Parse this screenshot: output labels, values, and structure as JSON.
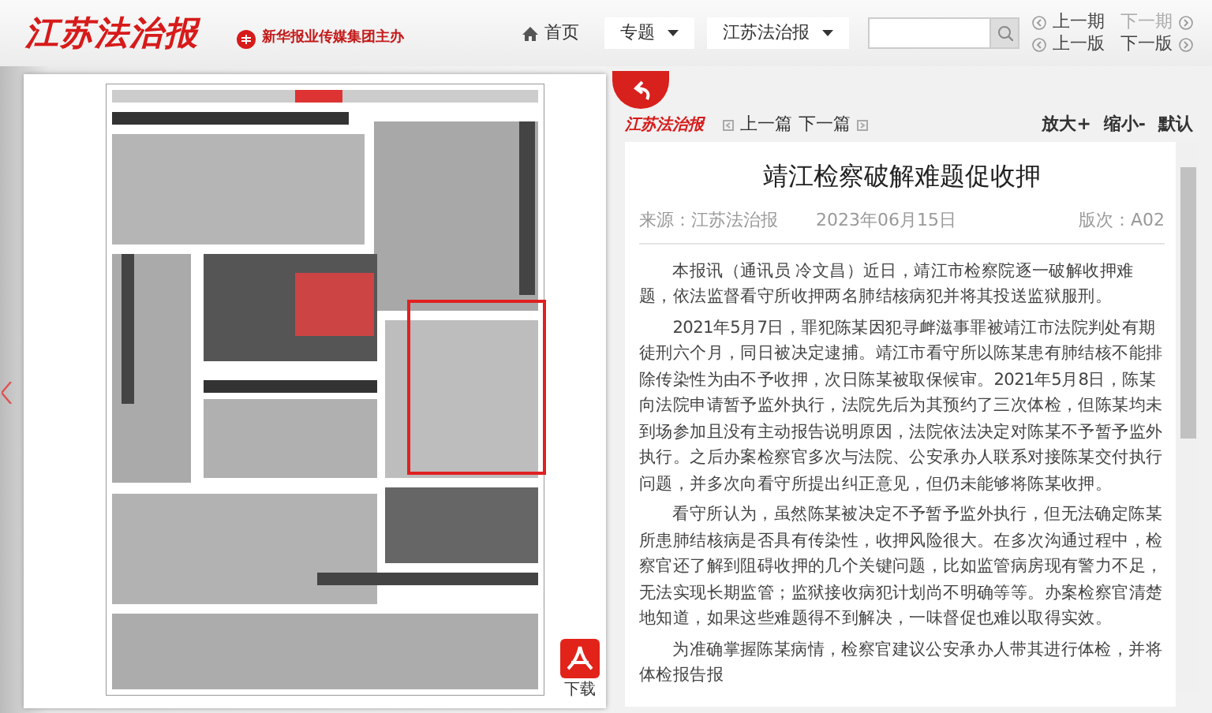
{
  "header": {
    "logo": "江苏法治报",
    "sponsor": "新华报业传媒集团主办",
    "nav": [
      {
        "label": "首页",
        "kind": "home"
      },
      {
        "label": "专题",
        "kind": "dropdown"
      },
      {
        "label": "江苏法治报",
        "kind": "dropdown"
      }
    ],
    "search": {
      "kind": "search"
    },
    "issue_nav": [
      {
        "label": "上一期",
        "kind": "prev",
        "disabled": false
      },
      {
        "label": "下一期",
        "kind": "next",
        "disabled": true
      },
      {
        "label": "上一版",
        "kind": "prev",
        "disabled": false
      },
      {
        "label": "下一版",
        "kind": "next",
        "disabled": false
      }
    ]
  },
  "page_view": {
    "download": "下载"
  },
  "article_toolbar": {
    "logo": "江苏法治报",
    "links": [
      {
        "label": "上一篇",
        "kind": "prev"
      },
      {
        "label": "下一篇",
        "kind": "next"
      }
    ],
    "zoom": [
      "放大+",
      "缩小-",
      "默认"
    ]
  },
  "article": {
    "title": "靖江检察破解难题促收押",
    "source": "来源：江苏法治报",
    "date": "2023年06月15日",
    "edition": "版次：A02",
    "paragraphs": [
      "本报讯（通讯员 冷文昌）近日，靖江市检察院逐一破解收押难题，依法监督看守所收押两名肺结核病犯并将其投送监狱服刑。",
      "2021年5月7日，罪犯陈某因犯寻衅滋事罪被靖江市法院判处有期徒刑六个月，同日被决定逮捕。靖江市看守所以陈某患有肺结核不能排除传染性为由不予收押，次日陈某被取保候审。2021年5月8日，陈某向法院申请暂予监外执行，法院先后为其预约了三次体检，但陈某均未到场参加且没有主动报告说明原因，法院依法决定对陈某不予暂予监外执行。之后办案检察官多次与法院、公安承办人联系对接陈某交付执行问题，并多次向看守所提出纠正意见，但仍未能够将陈某收押。",
      "看守所认为，虽然陈某被决定不予暂予监外执行，但无法确定陈某所患肺结核病是否具有传染性，收押风险很大。在多次沟通过程中，检察官还了解到阻碍收押的几个关键问题，比如监管病房现有警力不足，无法实现长期监管；监狱接收病犯计划尚不明确等等。办案检察官清楚地知道，如果这些难题得不到解决，一味督促也难以取得实效。",
      "为准确掌握陈某病情，检察官建议公安承办人带其进行体检，并将体检报告报"
    ]
  }
}
